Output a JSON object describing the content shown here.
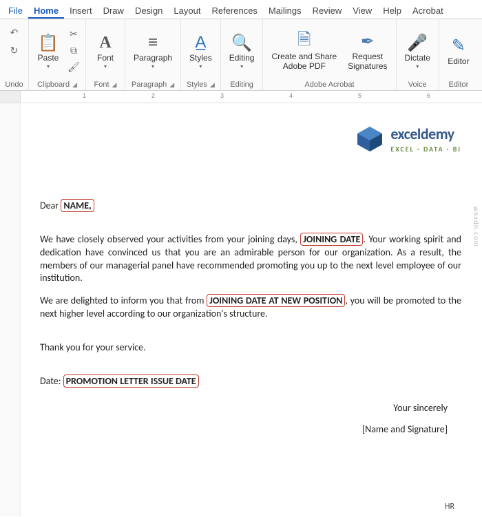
{
  "menu": {
    "file": "File",
    "home": "Home",
    "insert": "Insert",
    "draw": "Draw",
    "design": "Design",
    "layout": "Layout",
    "references": "References",
    "mailings": "Mailings",
    "review": "Review",
    "view": "View",
    "help": "Help",
    "acrobat": "Acrobat"
  },
  "ribbon": {
    "undo_group": "Undo",
    "clipboard_group": "Clipboard",
    "paste": "Paste",
    "font_group": "Font",
    "font": "Font",
    "paragraph_group": "Paragraph",
    "paragraph": "Paragraph",
    "styles_group": "Styles",
    "styles": "Styles",
    "editing_group": "Editing",
    "editing": "Editing",
    "adobe_group": "Adobe Acrobat",
    "create_share": "Create and Share\nAdobe PDF",
    "request_sig": "Request\nSignatures",
    "voice_group": "Voice",
    "dictate": "Dictate",
    "editor_group": "Editor",
    "editor": "Editor"
  },
  "ruler": {
    "m1": "1",
    "m2": "2",
    "m3": "3",
    "m4": "4",
    "m5": "5",
    "m6": "6"
  },
  "logo": {
    "main": "exceldemy",
    "sub": "EXCEL · DATA · BI"
  },
  "doc": {
    "greeting_pre": "Dear ",
    "name_ph": "NAME,",
    "p1_a": "We have closely observed your activities from your joining days, ",
    "join_ph": "JOINING DATE",
    "p1_b": ". Your working spirit and dedication have convinced us that you are an admirable person for our organization. As a result, the members of our managerial panel have recommended promoting you up to the next level employee of our institution.",
    "p2_a": "We are delighted to inform you that from ",
    "newpos_ph": "JOINING DATE AT NEW POSITION",
    "p2_b": ", you will be promoted to the next higher level according to our organization's structure.",
    "thanks": "Thank you for your service.",
    "date_pre": "Date: ",
    "issue_ph": "PROMOTION LETTER ISSUE DATE",
    "closing": "Your sincerely",
    "sig": "[Name and Signature]",
    "hr": "HR"
  },
  "watermark": "wsxdn.com"
}
